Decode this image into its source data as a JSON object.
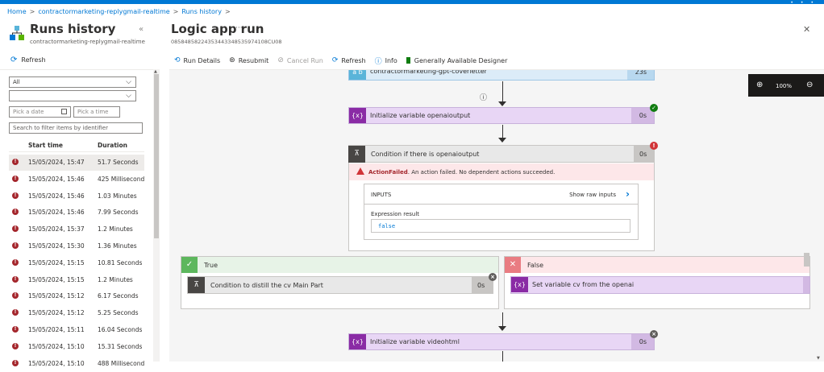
{
  "breadcrumb": [
    "Home",
    "contractormarketing-replygmail-realtime",
    "Runs history"
  ],
  "left_panel": {
    "title": "Runs history",
    "subtitle": "contractormarketing-replygmail-realtime",
    "refresh_label": "Refresh",
    "status_filter": "All",
    "second_filter": "",
    "date_placeholder": "Pick a date",
    "time_placeholder": "Pick a time",
    "search_placeholder": "Search to filter items by identifier",
    "columns": [
      "Start time",
      "Duration"
    ],
    "runs": [
      {
        "start": "15/05/2024, 15:47",
        "duration": "51.7 Seconds",
        "status": "failed",
        "selected": true
      },
      {
        "start": "15/05/2024, 15:46",
        "duration": "425 Milliseconds",
        "status": "failed"
      },
      {
        "start": "15/05/2024, 15:46",
        "duration": "1.03 Minutes",
        "status": "failed"
      },
      {
        "start": "15/05/2024, 15:46",
        "duration": "7.99 Seconds",
        "status": "failed"
      },
      {
        "start": "15/05/2024, 15:37",
        "duration": "1.2 Minutes",
        "status": "failed"
      },
      {
        "start": "15/05/2024, 15:30",
        "duration": "1.36 Minutes",
        "status": "failed"
      },
      {
        "start": "15/05/2024, 15:15",
        "duration": "10.81 Seconds",
        "status": "failed"
      },
      {
        "start": "15/05/2024, 15:15",
        "duration": "1.2 Minutes",
        "status": "failed"
      },
      {
        "start": "15/05/2024, 15:12",
        "duration": "6.17 Seconds",
        "status": "failed"
      },
      {
        "start": "15/05/2024, 15:12",
        "duration": "5.25 Seconds",
        "status": "failed"
      },
      {
        "start": "15/05/2024, 15:11",
        "duration": "16.04 Seconds",
        "status": "failed"
      },
      {
        "start": "15/05/2024, 15:10",
        "duration": "15.31 Seconds",
        "status": "failed"
      },
      {
        "start": "15/05/2024, 15:10",
        "duration": "488 Milliseconds",
        "status": "failed"
      }
    ]
  },
  "run_panel": {
    "title": "Logic app run",
    "run_id": "08584858224353443348535974108CU08",
    "toolbar": {
      "run_details": "Run Details",
      "resubmit": "Resubmit",
      "cancel_run": "Cancel Run",
      "refresh": "Refresh",
      "info": "Info",
      "designer": "Generally Available Designer"
    },
    "zoom": "100%"
  },
  "flow": {
    "top_action": {
      "label": "contractormarketing-gpt-coverletter",
      "duration": "23s"
    },
    "init_openai": {
      "label": "Initialize variable openaioutput",
      "duration": "0s",
      "icon": "{x}"
    },
    "condition": {
      "label": "Condition if there is openaioutput",
      "duration": "0s",
      "error_title": "ActionFailed",
      "error_text": ". An action failed. No dependent actions succeeded.",
      "inputs_label": "INPUTS",
      "show_raw": "Show raw inputs",
      "expression_label": "Expression result",
      "expression_value": "false"
    },
    "true_branch": {
      "label": "True",
      "action": "Condition to distill the cv Main Part",
      "duration": "0s"
    },
    "false_branch": {
      "label": "False",
      "action": "Set variable cv from the openai",
      "icon": "{x}"
    },
    "init_video": {
      "label": "Initialize variable videohtml",
      "duration": "0s",
      "icon": "{x}"
    }
  },
  "colors": {
    "accent": "#0078d4",
    "variable": "#8a2ba5",
    "error": "#d13438",
    "success": "#107c10"
  }
}
